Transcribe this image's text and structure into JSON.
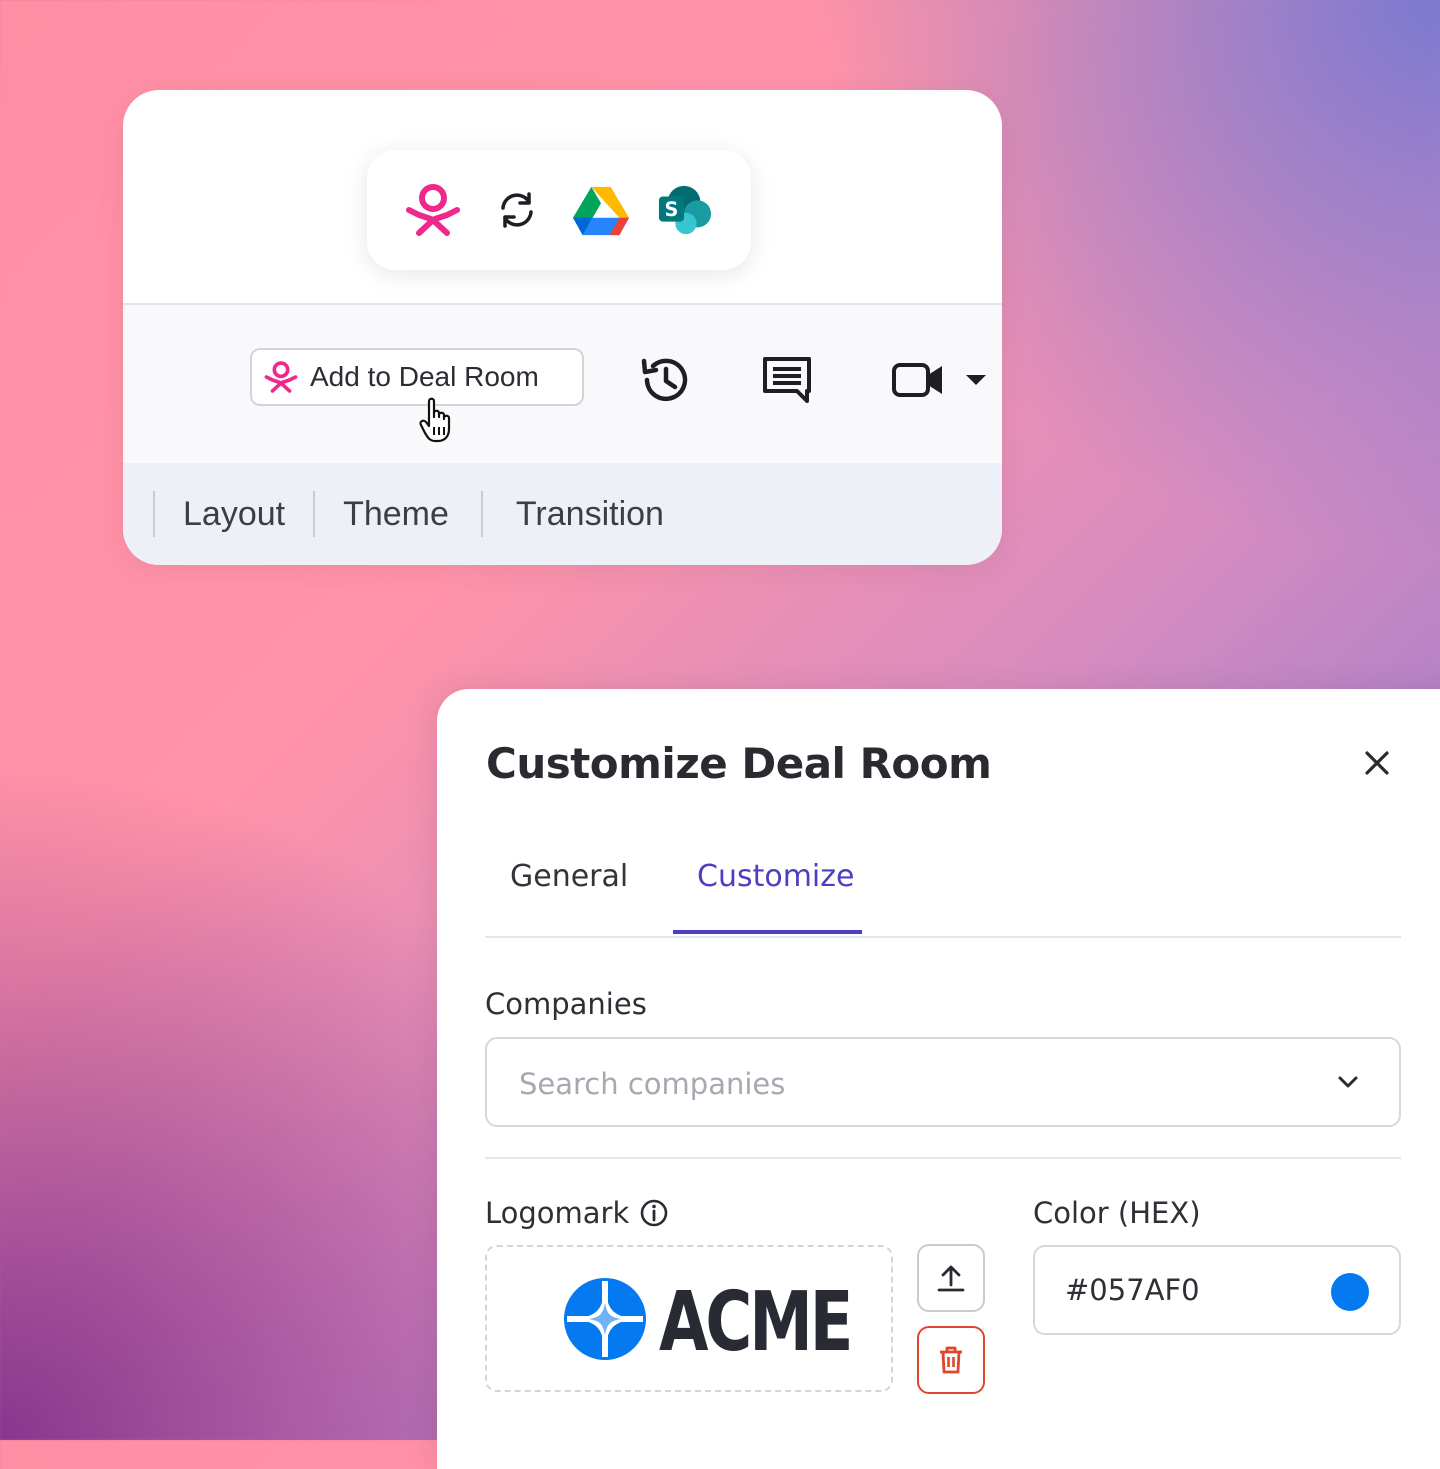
{
  "toolbar": {
    "add_to_deal_room_label": "Add to Deal Room"
  },
  "ribbon": {
    "tabs": [
      "Layout",
      "Theme",
      "Transition"
    ]
  },
  "dialog": {
    "title": "Customize Deal Room",
    "tabs": [
      {
        "label": "General",
        "active": false
      },
      {
        "label": "Customize",
        "active": true
      }
    ],
    "companies": {
      "label": "Companies",
      "placeholder": "Search companies"
    },
    "logomark": {
      "label": "Logomark",
      "logo_text": "ACME"
    },
    "color": {
      "label": "Color (HEX)",
      "value": "#057AF0"
    }
  },
  "colors": {
    "accent": "#4C3FC3",
    "brand_pink": "#F0288C",
    "delete_red": "#E0462B",
    "acme_blue": "#057AF0"
  },
  "icons": [
    "deal-room-logo-icon",
    "sync-icon",
    "google-drive-icon",
    "sharepoint-icon",
    "history-icon",
    "comments-icon",
    "video-camera-icon",
    "caret-down-icon",
    "pointer-cursor-icon",
    "close-icon",
    "chevron-down-icon",
    "info-icon",
    "upload-icon",
    "trash-icon"
  ]
}
